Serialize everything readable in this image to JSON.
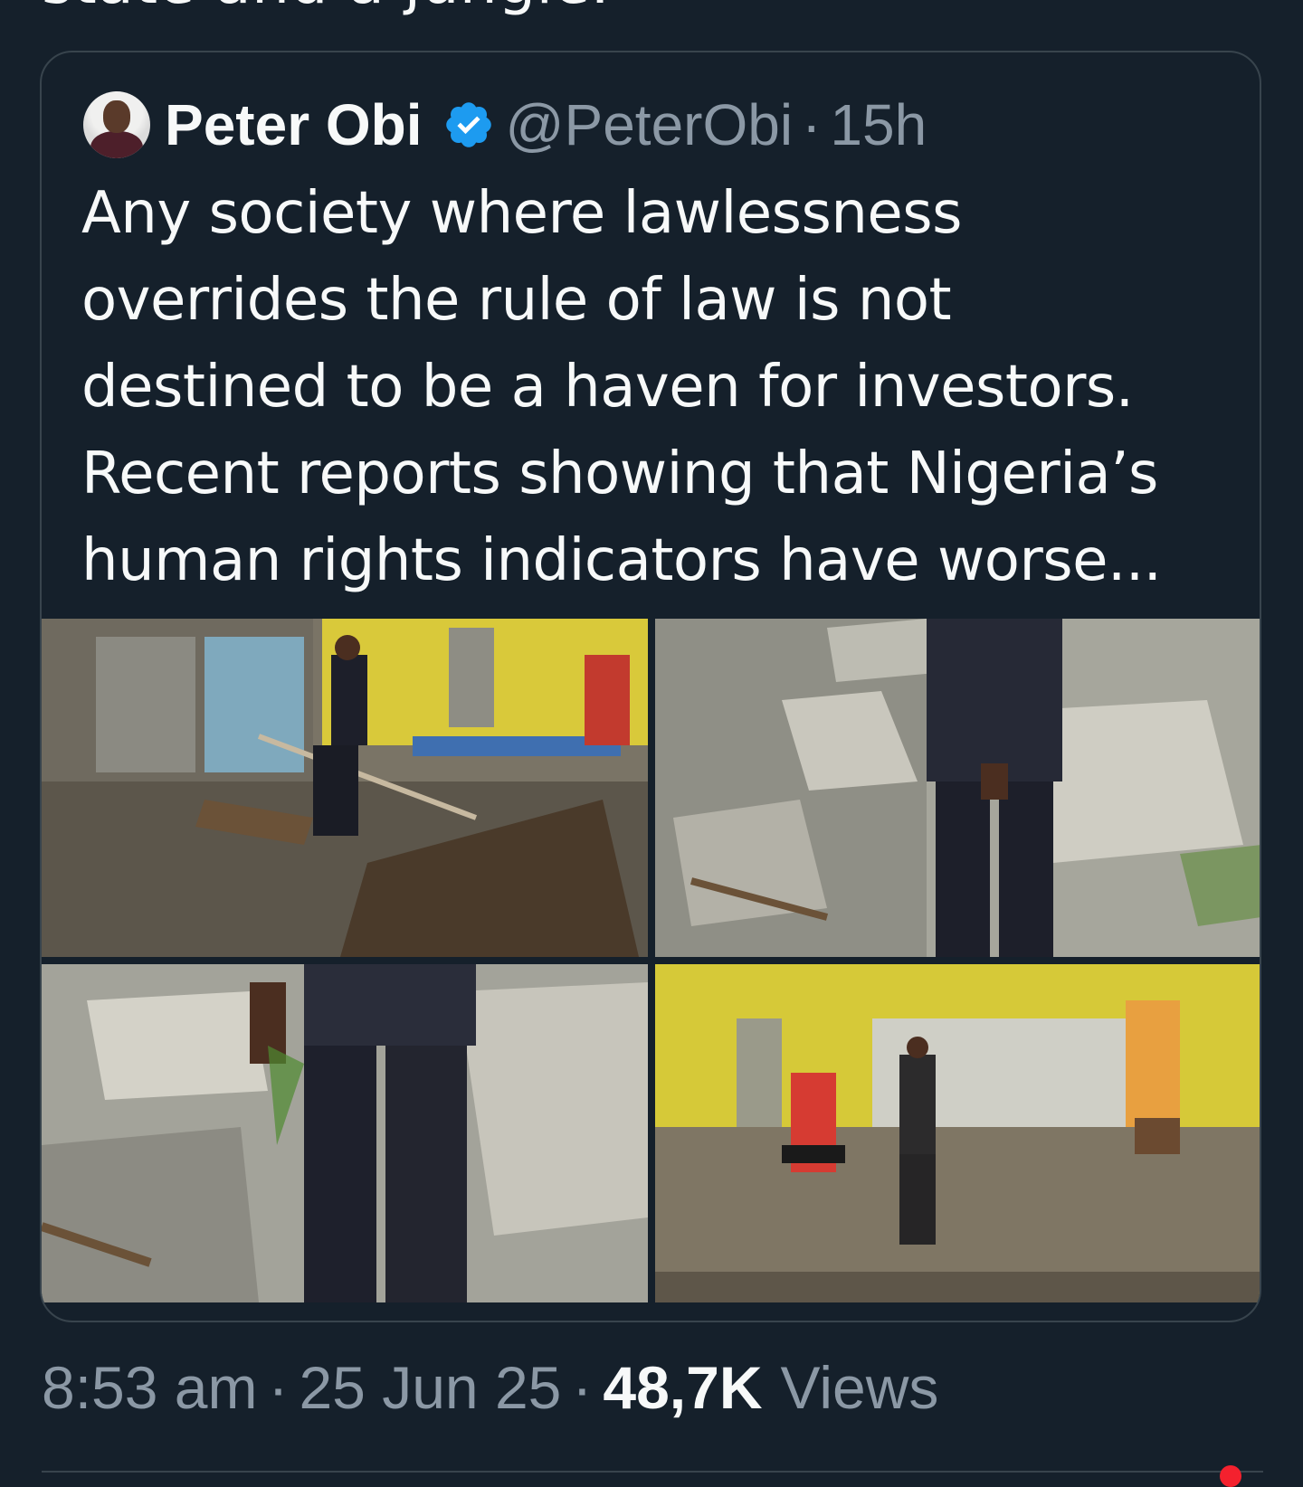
{
  "parent_tweet": {
    "visible_fragment": "state and a jungle."
  },
  "quoted_tweet": {
    "author_name": "Peter Obi",
    "handle": "@PeterObi",
    "separator": "·",
    "relative_time": "15h",
    "text_lines": [
      "Any society where lawlessness",
      "overrides the rule of law is not",
      "destined to be a haven for investors.",
      "Recent reports showing that Nigeria’s",
      "human rights indicators have worse..."
    ],
    "media": [
      {
        "description": "man walking over burnt demolished shop with yellow wall"
      },
      {
        "description": "man standing in concrete rubble"
      },
      {
        "description": "close-up of man's legs amid concrete rubble"
      },
      {
        "description": "man standing in demolished yellow building with red tyre machine"
      }
    ]
  },
  "meta": {
    "time": "8:53 am",
    "date": "25 Jun 25",
    "separator": "·",
    "views_count": "48,7K",
    "views_label": "Views"
  },
  "colors": {
    "background": "#15202b",
    "border": "#38444d",
    "muted_text": "#8b98a5",
    "primary_text": "#f7f9f9",
    "verified_blue": "#1d9bf0",
    "notification_red": "#f4212e"
  },
  "icons": {
    "verified": "verified-badge-icon"
  }
}
